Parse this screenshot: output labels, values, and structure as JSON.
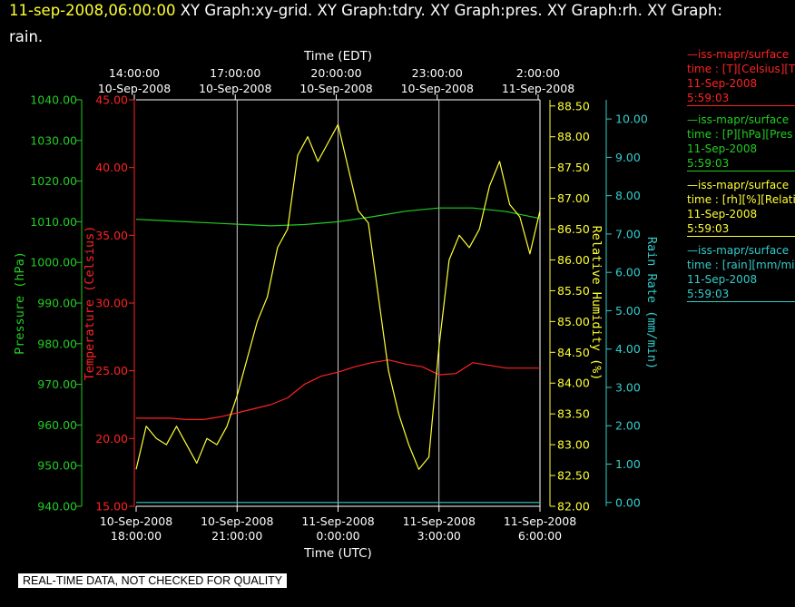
{
  "title": {
    "timestamp": "11-sep-2008,06:00:00",
    "text_line1": "XY Graph:xy-grid.  XY Graph:tdry.  XY Graph:pres.  XY Graph:rh.  XY Graph:",
    "text_line2": "rain."
  },
  "legend": [
    {
      "line1": "—iss-mapr/surface",
      "line2": "time : [T][Celsius][T",
      "line3": "11-Sep-2008",
      "line4": "5:59:03",
      "color": "#ff2222"
    },
    {
      "line1": "—iss-mapr/surface",
      "line2": "time : [P][hPa][Pres",
      "line3": "11-Sep-2008",
      "line4": "5:59:03",
      "color": "#22cc22"
    },
    {
      "line1": "—iss-mapr/surface",
      "line2": "time : [rh][%][Relati",
      "line3": "11-Sep-2008",
      "line4": "5:59:03",
      "color": "#ffff33"
    },
    {
      "line1": "—iss-mapr/surface",
      "line2": "time : [rain][mm/min",
      "line3": "11-Sep-2008",
      "line4": "5:59:03",
      "color": "#33cccc"
    }
  ],
  "notice": "REAL-TIME DATA, NOT CHECKED FOR QUALITY",
  "chart_data": {
    "type": "line",
    "x_axis_bottom": {
      "label": "Time (UTC)",
      "ticks": [
        {
          "date": "10-Sep-2008",
          "time": "18:00:00",
          "hours": 0
        },
        {
          "date": "10-Sep-2008",
          "time": "21:00:00",
          "hours": 3
        },
        {
          "date": "11-Sep-2008",
          "time": "0:00:00",
          "hours": 6
        },
        {
          "date": "11-Sep-2008",
          "time": "3:00:00",
          "hours": 9
        },
        {
          "date": "11-Sep-2008",
          "time": "6:00:00",
          "hours": 12
        }
      ],
      "range_hours": [
        0,
        12
      ]
    },
    "x_axis_top": {
      "label": "Time (EDT)",
      "ticks": [
        {
          "time": "14:00:00",
          "date": "10-Sep-2008"
        },
        {
          "time": "17:00:00",
          "date": "10-Sep-2008"
        },
        {
          "time": "20:00:00",
          "date": "10-Sep-2008"
        },
        {
          "time": "23:00:00",
          "date": "10-Sep-2008"
        },
        {
          "time": "2:00:00",
          "date": "11-Sep-2008"
        }
      ]
    },
    "grid": true,
    "axes": {
      "pressure": {
        "label": "Pressure (hPa)",
        "range": [
          940,
          1040
        ],
        "ticks": [
          "940.00",
          "950.00",
          "960.00",
          "970.00",
          "980.00",
          "990.00",
          "1000.00",
          "1010.00",
          "1020.00",
          "1030.00",
          "1040.00"
        ],
        "color": "#22cc22"
      },
      "temperature": {
        "label": "Temperature (Celsius)",
        "range": [
          15,
          45
        ],
        "ticks": [
          "15.00",
          "20.00",
          "25.00",
          "30.00",
          "35.00",
          "40.00",
          "45.00"
        ],
        "color": "#ff2222"
      },
      "rh": {
        "label": "Relative Humidity (%)",
        "range": [
          82,
          88.6
        ],
        "ticks": [
          "82.00",
          "82.50",
          "83.00",
          "83.50",
          "84.00",
          "84.50",
          "85.00",
          "85.50",
          "86.00",
          "86.50",
          "87.00",
          "87.50",
          "88.00",
          "88.50"
        ],
        "color": "#ffff33"
      },
      "rain": {
        "label": "Rain Rate (mm/min)",
        "range": [
          -0.1,
          10.5
        ],
        "ticks": [
          "0.00",
          "1.00",
          "2.00",
          "3.00",
          "4.00",
          "5.00",
          "6.00",
          "7.00",
          "8.00",
          "9.00",
          "10.00"
        ],
        "color": "#33cccc"
      }
    },
    "series": [
      {
        "name": "[T][Celsius]",
        "axis": "temperature",
        "color": "#ff2222",
        "x": [
          0,
          0.5,
          1,
          1.5,
          2,
          2.5,
          3,
          3.5,
          4,
          4.5,
          5,
          5.5,
          6,
          6.5,
          7,
          7.5,
          8,
          8.5,
          9,
          9.5,
          10,
          10.5,
          11,
          11.5,
          12
        ],
        "y": [
          21.5,
          21.5,
          21.5,
          21.4,
          21.4,
          21.6,
          21.9,
          22.2,
          22.5,
          23.0,
          24.0,
          24.6,
          24.9,
          25.3,
          25.6,
          25.8,
          25.5,
          25.3,
          24.7,
          24.8,
          25.6,
          25.4,
          25.2,
          25.2,
          25.2
        ]
      },
      {
        "name": "[P][hPa]",
        "axis": "pressure",
        "color": "#22cc22",
        "x": [
          0,
          1,
          2,
          3,
          4,
          5,
          6,
          7,
          8,
          9,
          10,
          11,
          12
        ],
        "y": [
          1010.6,
          1010.2,
          1009.8,
          1009.4,
          1009.0,
          1009.3,
          1010.0,
          1011.2,
          1012.6,
          1013.4,
          1013.4,
          1012.5,
          1010.8
        ]
      },
      {
        "name": "[rh][%]",
        "axis": "rh",
        "color": "#ffff33",
        "x": [
          0,
          0.3,
          0.6,
          0.9,
          1.2,
          1.5,
          1.8,
          2.1,
          2.4,
          2.7,
          3.0,
          3.3,
          3.6,
          3.9,
          4.2,
          4.5,
          4.8,
          5.1,
          5.4,
          5.7,
          6.0,
          6.3,
          6.6,
          6.9,
          7.2,
          7.5,
          7.8,
          8.1,
          8.4,
          8.7,
          9.0,
          9.3,
          9.6,
          9.9,
          10.2,
          10.5,
          10.8,
          11.1,
          11.4,
          11.7,
          12.0
        ],
        "y": [
          82.6,
          83.3,
          83.1,
          83.0,
          83.3,
          83.0,
          82.7,
          83.1,
          83.0,
          83.3,
          83.8,
          84.4,
          85.0,
          85.4,
          86.2,
          86.5,
          87.7,
          88.0,
          87.6,
          87.9,
          88.2,
          87.5,
          86.8,
          86.6,
          85.4,
          84.2,
          83.5,
          83.0,
          82.6,
          82.8,
          84.6,
          86.0,
          86.4,
          86.2,
          86.5,
          87.2,
          87.6,
          86.9,
          86.7,
          86.1,
          86.8
        ]
      },
      {
        "name": "[rain][mm/min]",
        "axis": "rain",
        "color": "#33cccc",
        "x": [
          0,
          6,
          12
        ],
        "y": [
          0.0,
          0.0,
          0.0
        ]
      }
    ]
  }
}
